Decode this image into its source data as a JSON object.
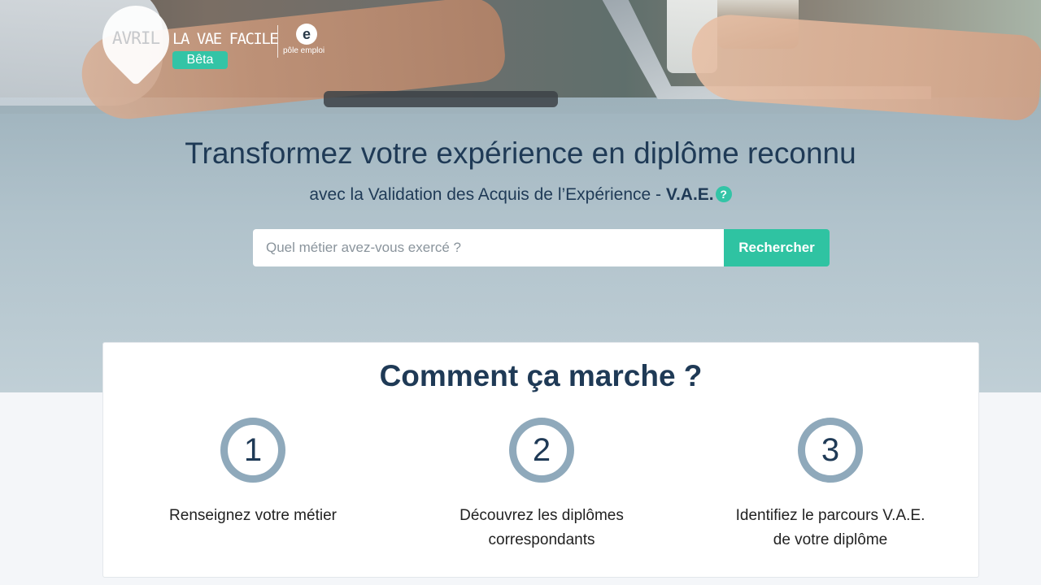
{
  "logo": {
    "avril": "AVRIL",
    "tagline": "LA VAE FACILE",
    "badge": "Bêta",
    "partner_mark": "e",
    "partner_name": "pôle emploi"
  },
  "hero": {
    "title": "Transformez votre expérience en diplôme reconnu",
    "subtitle_prefix": "avec la Validation des Acquis de l’Expérience - ",
    "subtitle_acronym": "V.A.E.",
    "help_icon": "?"
  },
  "search": {
    "placeholder": "Quel métier avez-vous exercé ?",
    "button_label": "Rechercher"
  },
  "how_it_works": {
    "title": "Comment ça marche ?",
    "steps": [
      {
        "number": "1",
        "text_line1": "Renseignez votre métier",
        "text_line2": ""
      },
      {
        "number": "2",
        "text_line1": "Découvrez les diplômes",
        "text_line2": "correspondants"
      },
      {
        "number": "3",
        "text_line1": "Identifiez le parcours V.A.E.",
        "text_line2": "de votre diplôme"
      }
    ]
  },
  "colors": {
    "accent": "#2fc3a2",
    "heading": "#1f3a56",
    "step_ring": "#8fa9bb"
  }
}
